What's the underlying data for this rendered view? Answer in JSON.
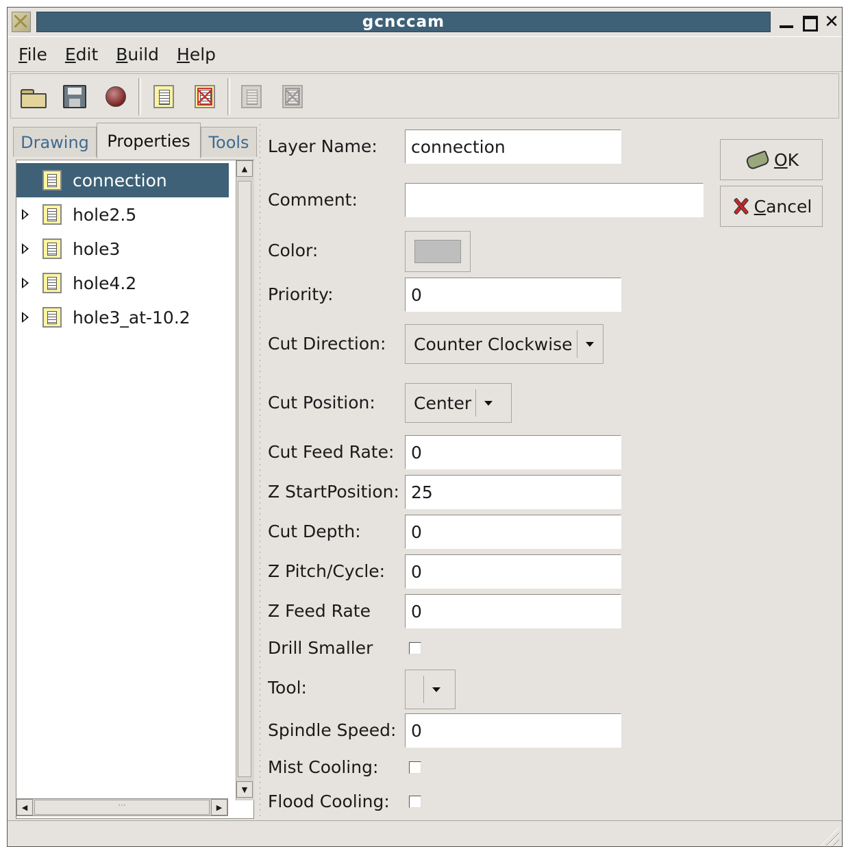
{
  "window": {
    "title": "gcnccam"
  },
  "menubar": {
    "items": [
      {
        "mnemonic": "F",
        "rest": "ile"
      },
      {
        "mnemonic": "E",
        "rest": "dit"
      },
      {
        "mnemonic": "B",
        "rest": "uild"
      },
      {
        "mnemonic": "H",
        "rest": "elp"
      }
    ]
  },
  "toolbar": {
    "icons": [
      "open-folder-icon",
      "save-floppy-icon",
      "record-icon",
      "layer-icon",
      "delete-layer-icon",
      "layer-disabled-icon",
      "delete-layer-disabled-icon"
    ]
  },
  "tabs": [
    "Drawing",
    "Properties",
    "Tools"
  ],
  "tree": {
    "items": [
      {
        "label": "connection",
        "selected": true,
        "expandable": false
      },
      {
        "label": "hole2.5",
        "selected": false,
        "expandable": true
      },
      {
        "label": "hole3",
        "selected": false,
        "expandable": true
      },
      {
        "label": "hole4.2",
        "selected": false,
        "expandable": true
      },
      {
        "label": "hole3_at-10.2",
        "selected": false,
        "expandable": true
      }
    ],
    "hscroll_thumb_text": "···"
  },
  "form": {
    "layer_name": {
      "label": "Layer Name:",
      "value": "connection"
    },
    "comment": {
      "label": "Comment:",
      "value": ""
    },
    "color": {
      "label": "Color:",
      "swatch": "#bebebe"
    },
    "priority": {
      "label": "Priority:",
      "value": "0"
    },
    "cut_direction": {
      "label": "Cut Direction:",
      "value": "Counter Clockwise"
    },
    "cut_position": {
      "label": "Cut Position:",
      "value": "Center"
    },
    "cut_feed_rate": {
      "label": "Cut Feed Rate:",
      "value": "0"
    },
    "z_start_position": {
      "label": "Z StartPosition:",
      "value": "25"
    },
    "cut_depth": {
      "label": "Cut Depth:",
      "value": "0"
    },
    "z_pitch_cycle": {
      "label": "Z Pitch/Cycle:",
      "value": "0"
    },
    "z_feed_rate": {
      "label": "Z Feed Rate",
      "value": "0"
    },
    "drill_smaller": {
      "label": "Drill Smaller",
      "checked": false
    },
    "tool": {
      "label": "Tool:",
      "value": ""
    },
    "spindle_speed": {
      "label": "Spindle Speed:",
      "value": "0"
    },
    "mist_cooling": {
      "label": "Mist Cooling:",
      "checked": false
    },
    "flood_cooling": {
      "label": "Flood Cooling:",
      "checked": false
    }
  },
  "buttons": {
    "ok": {
      "mnemonic": "O",
      "rest": "K"
    },
    "cancel": {
      "mnemonic": "C",
      "rest": "ancel"
    }
  },
  "colors": {
    "selection": "#3e6177",
    "title_bar": "#3e6177",
    "window_bg": "#e6e3de",
    "tab_text": "#3f6a90"
  }
}
